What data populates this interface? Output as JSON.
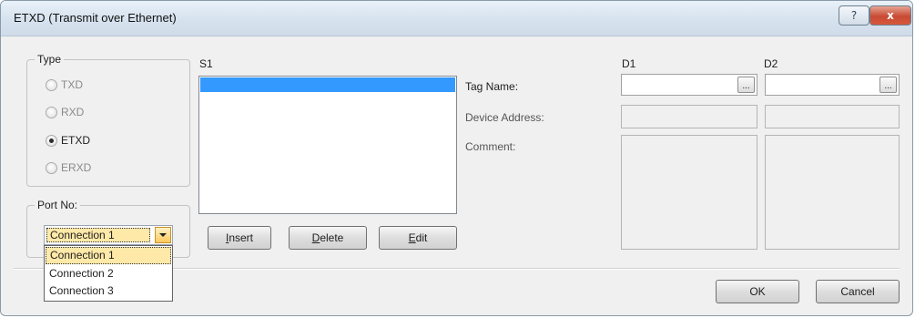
{
  "window": {
    "title": "ETXD (Transmit over Ethernet)",
    "help_glyph": "?",
    "close_glyph": "x"
  },
  "type_group": {
    "legend": "Type",
    "options": [
      {
        "label": "TXD",
        "checked": false
      },
      {
        "label": "RXD",
        "checked": false
      },
      {
        "label": "ETXD",
        "checked": true
      },
      {
        "label": "ERXD",
        "checked": false
      }
    ]
  },
  "port_group": {
    "legend": "Port No:",
    "selected": "Connection 1",
    "options": [
      "Connection 1",
      "Connection 2",
      "Connection 3"
    ]
  },
  "s1": {
    "label": "S1",
    "buttons": [
      {
        "label_pre": "",
        "mnemonic": "I",
        "label_post": "nsert"
      },
      {
        "label_pre": "",
        "mnemonic": "D",
        "label_post": "elete"
      },
      {
        "label_pre": "",
        "mnemonic": "E",
        "label_post": "dit"
      }
    ]
  },
  "fields": {
    "tag_name": "Tag Name:",
    "device_address": "Device Address:",
    "comment": "Comment:"
  },
  "d1": {
    "label": "D1",
    "browse": "..."
  },
  "d2": {
    "label": "D2",
    "browse": "..."
  },
  "footer": {
    "ok": "OK",
    "cancel": "Cancel"
  }
}
